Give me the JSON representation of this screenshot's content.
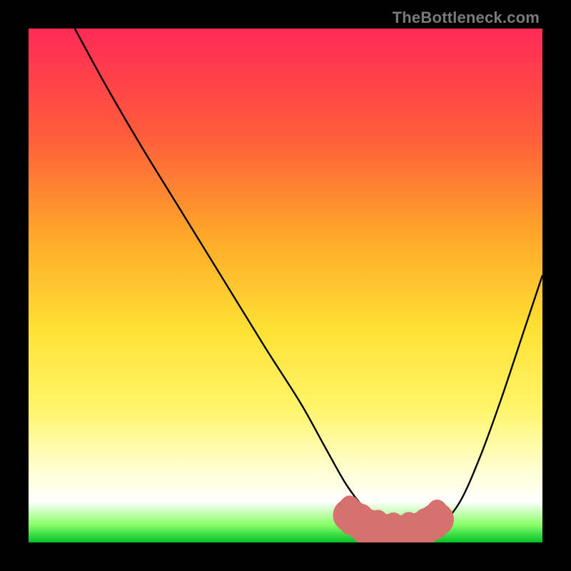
{
  "watermark": "TheBottleneck.com",
  "chart_data": {
    "type": "line",
    "title": "",
    "xlabel": "",
    "ylabel": "",
    "xlim": [
      0,
      100
    ],
    "ylim": [
      0,
      100
    ],
    "grid": false,
    "legend": null,
    "gradient_stops": [
      {
        "offset": 0.0,
        "color": "#ff2a55"
      },
      {
        "offset": 0.2,
        "color": "#ff5a3c"
      },
      {
        "offset": 0.4,
        "color": "#ffa629"
      },
      {
        "offset": 0.58,
        "color": "#ffe032"
      },
      {
        "offset": 0.74,
        "color": "#fff56a"
      },
      {
        "offset": 0.86,
        "color": "#ffffd2"
      },
      {
        "offset": 0.92,
        "color": "#ffffff"
      },
      {
        "offset": 0.965,
        "color": "#8bff6a"
      },
      {
        "offset": 1.0,
        "color": "#00c227"
      }
    ],
    "series": [
      {
        "name": "bottleneck-curve",
        "color": "#000000",
        "x": [
          9,
          15,
          22,
          30,
          38,
          46,
          53,
          58,
          62,
          66,
          70,
          74,
          78,
          80,
          84,
          88,
          92,
          96,
          100
        ],
        "y": [
          100,
          89,
          77,
          64,
          51,
          38,
          27,
          18,
          11,
          6,
          3,
          2,
          2,
          3,
          8,
          17,
          28,
          40,
          52
        ]
      }
    ],
    "highlight_band": {
      "name": "optimal-zone",
      "color": "#d6716f",
      "points_x": [
        62.5,
        65,
        68,
        71,
        74,
        77,
        79.5
      ],
      "points_y": [
        5.3,
        3.6,
        2.5,
        2.0,
        2.1,
        2.8,
        4.5
      ],
      "thickness": 2.4
    }
  }
}
